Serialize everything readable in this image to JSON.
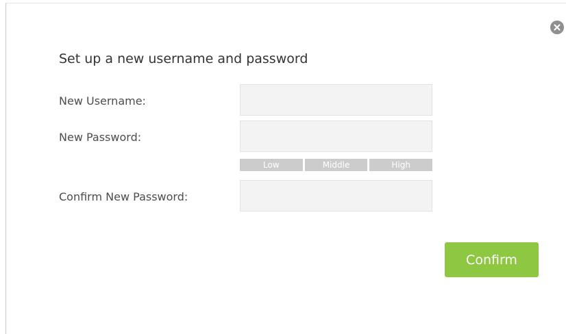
{
  "dialog": {
    "title": "Set up a new username and password",
    "close_icon": "close-circle-icon"
  },
  "form": {
    "username_label": "New Username:",
    "username_value": "",
    "password_label": "New Password:",
    "password_value": "",
    "confirm_password_label": "Confirm New Password:",
    "confirm_password_value": ""
  },
  "strength_meter": {
    "levels": [
      "Low",
      "Middle",
      "High"
    ],
    "segment_color": "#cccccc"
  },
  "actions": {
    "confirm_label": "Confirm",
    "confirm_color": "#8ec742"
  }
}
